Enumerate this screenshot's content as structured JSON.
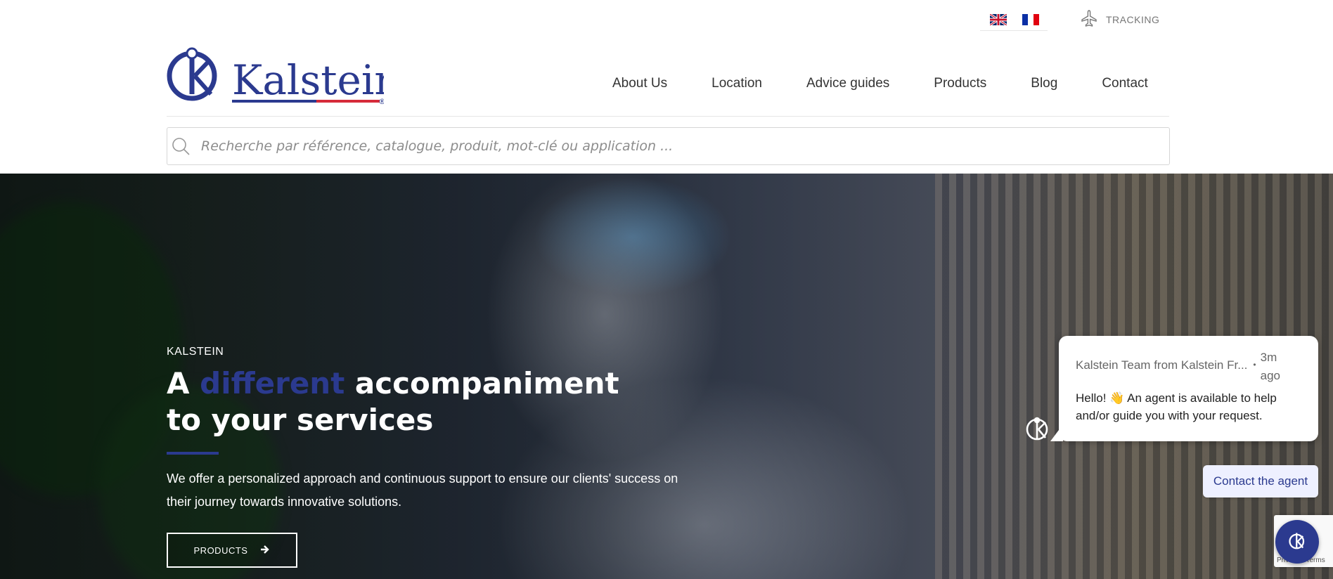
{
  "topbar": {
    "languages": [
      {
        "name": "english-flag-icon",
        "code": "en"
      },
      {
        "name": "french-flag-icon",
        "code": "fr"
      }
    ],
    "tracking_label": "TRACKING"
  },
  "brand": {
    "name": "Kalstein",
    "registered": "®",
    "primary_color": "#2b3a8f",
    "accent_color": "#d62b3a"
  },
  "nav": {
    "items": [
      "About Us",
      "Location",
      "Advice guides",
      "Products",
      "Blog",
      "Contact"
    ]
  },
  "search": {
    "placeholder": "Recherche par référence, catalogue, produit, mot-clé ou application ..."
  },
  "hero": {
    "kicker": "KALSTEIN",
    "headline_prefix": "A ",
    "headline_highlight": "different",
    "headline_line1_suffix": " accompaniment",
    "headline_line2": "to your services",
    "description": "We offer a personalized approach and continuous support to ensure our clients' success on their journey towards innovative solutions.",
    "button_label": "PRODUCTS"
  },
  "chat": {
    "sender": "Kalstein Team from Kalstein Fr...",
    "separator": "•",
    "time": "3m ago",
    "message": "Hello! 👋 An agent is available to help and/or guide you with your request.",
    "action_label": "Contact the agent"
  },
  "recaptcha": {
    "text": "Privacy - Terms"
  }
}
